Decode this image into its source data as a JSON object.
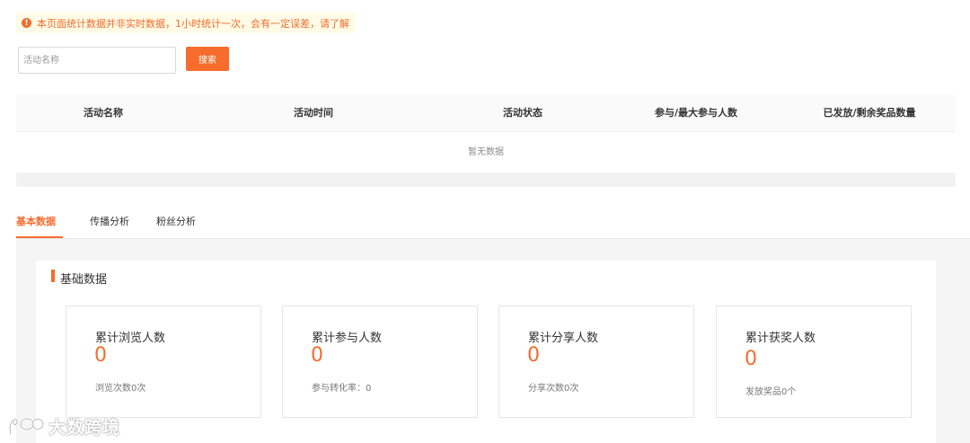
{
  "notice": {
    "text": "本页面统计数据并非实时数据，1小时统计一次，会有一定误差，请了解"
  },
  "search": {
    "placeholder": "活动名称",
    "button_label": "搜索"
  },
  "table": {
    "columns": [
      "活动名称",
      "活动时间",
      "活动状态",
      "参与/最大参与人数",
      "已发放/剩余奖品数量"
    ],
    "empty_text": "暂无数据"
  },
  "tabs": [
    {
      "label": "基本数据",
      "active": true
    },
    {
      "label": "传播分析",
      "active": false
    },
    {
      "label": "粉丝分析",
      "active": false
    }
  ],
  "section": {
    "title": "基础数据"
  },
  "cards": [
    {
      "title": "累计浏览人数",
      "value": "0",
      "sub": "浏览次数0次"
    },
    {
      "title": "累计参与人数",
      "value": "0",
      "sub": "参与转化率：0"
    },
    {
      "title": "累计分享人数",
      "value": "0",
      "sub": "分享次数0次"
    },
    {
      "title": "累计获奖人数",
      "value": "0",
      "sub": "发放奖品0个"
    }
  ],
  "watermark": {
    "text": "大数跨境"
  },
  "colors": {
    "accent": "#f56c2d",
    "notice_bg": "#fffbe6"
  }
}
